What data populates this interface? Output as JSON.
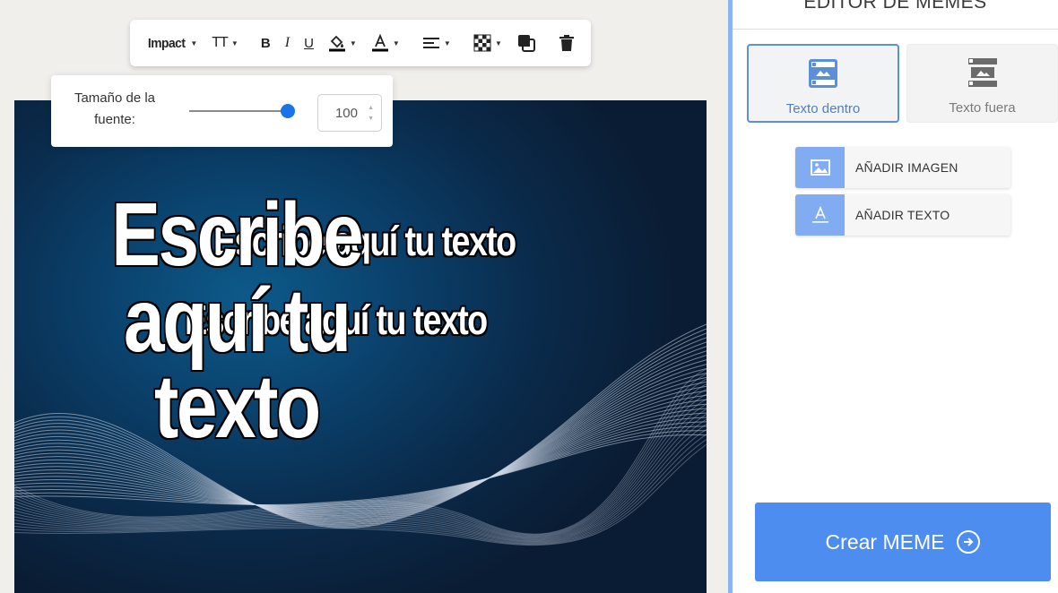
{
  "toolbar": {
    "font_name": "Impact",
    "text_size_glyph": "TT",
    "bold_glyph": "B",
    "italic_glyph": "I",
    "underline_glyph": "U",
    "fill_color": "#000000",
    "text_color": "#000000"
  },
  "font_size_popover": {
    "label": "Tamaño de la fuente:",
    "value": "100",
    "slider_level_percent": 100
  },
  "canvas": {
    "texts": [
      "Escribe aquí tu texto",
      "Escribe aquí tu texto",
      "Escribe aquí tu texto"
    ]
  },
  "panel": {
    "title": "EDITOR DE MEMES",
    "modes": [
      {
        "label": "Texto dentro",
        "active": true
      },
      {
        "label": "Texto fuera",
        "active": false
      }
    ],
    "add_image_label": "AÑADIR IMAGEN",
    "add_text_label": "AÑADIR TEXTO",
    "create_label": "Crear MEME"
  },
  "colors": {
    "accent": "#4d8df0",
    "accent_light": "#82acf2",
    "divider": "#8db4f0",
    "slider_thumb": "#1a73e8"
  }
}
